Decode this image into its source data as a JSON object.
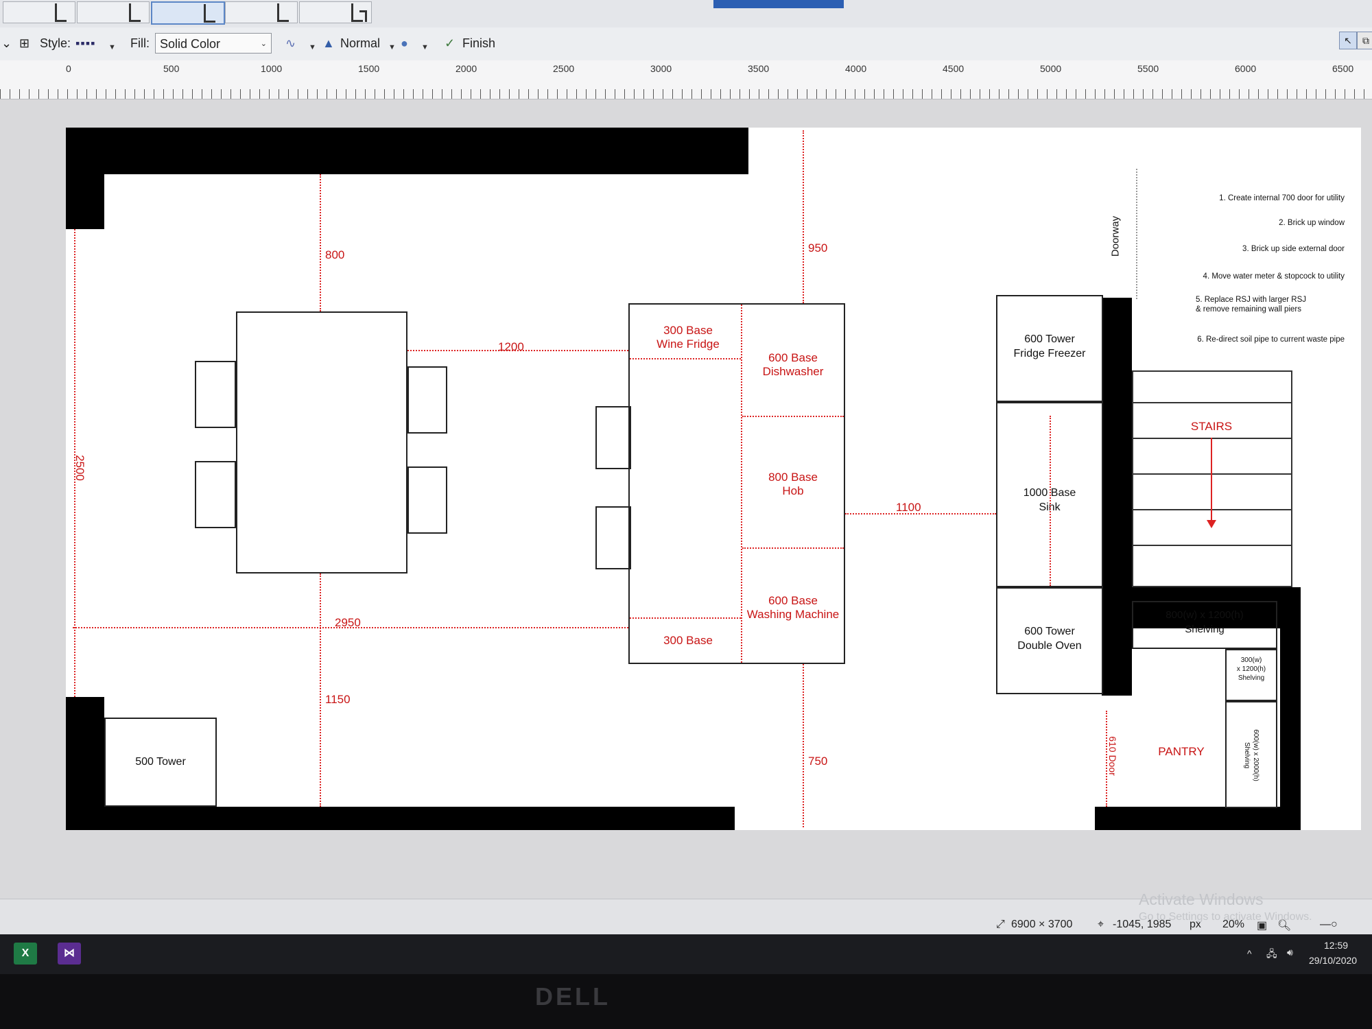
{
  "toolbar": {
    "style_label": "Style:",
    "style_sample": "▪▪▪▪",
    "fill_label": "Fill:",
    "fill_value": "Solid Color",
    "mode_value": "Normal",
    "finish_label": "Finish"
  },
  "ruler": {
    "labels": [
      "0",
      "500",
      "1000",
      "1500",
      "2000",
      "2500",
      "3000",
      "3500",
      "4000",
      "4500",
      "5000",
      "5500",
      "6000",
      "6500"
    ]
  },
  "plan": {
    "dimensions": {
      "d800": "800",
      "d950": "950",
      "d1200": "1200",
      "d2500": "2500",
      "d2950": "2950",
      "d1150": "1150",
      "d750": "750",
      "d1100": "1100"
    },
    "island_units": {
      "wine_fridge": "300 Base\nWine Fridge",
      "dishwasher": "600 Base\nDishwasher",
      "hob": "800 Base\nHob",
      "washing_machine": "600 Base\nWashing Machine",
      "base300": "300 Base"
    },
    "wall_units": {
      "fridge_freezer": "600 Tower\nFridge Freezer",
      "sink": "1000 Base\nSink",
      "double_oven": "600 Tower\nDouble Oven",
      "tower500": "500 Tower"
    },
    "doorway_label": "Doorway",
    "stairs_label": "STAIRS",
    "pantry_label": "PANTRY",
    "door610_label": "610 Door",
    "shelving_800": "800(w) x 1200(h)\nShelving",
    "shelving_300": "300(w)\nx 1200(h)\nShelving",
    "shelving_600": "600(w) x 2000(h)\nShelving",
    "notes": [
      "1. Create internal 700 door for utility",
      "2. Brick up window",
      "3. Brick up side external door",
      "4. Move water meter & stopcock to utility",
      "5. Replace RSJ with larger RSJ\n& remove remaining wall piers",
      "6. Re-direct soil pipe to current waste pipe"
    ]
  },
  "statusbar": {
    "canvas_size": "6900 × 3700",
    "cursor_pos": "-1045, 1985",
    "unit": "px",
    "zoom": "20%",
    "watermark_title": "Activate Windows",
    "watermark_sub": "Go to Settings to activate Windows."
  },
  "taskbar": {
    "time": "12:59",
    "date": "29/10/2020"
  },
  "brand": "DELL",
  "colors": {
    "dimension_red": "#d22222",
    "wall_black": "#000000",
    "canvas_white": "#ffffff"
  }
}
